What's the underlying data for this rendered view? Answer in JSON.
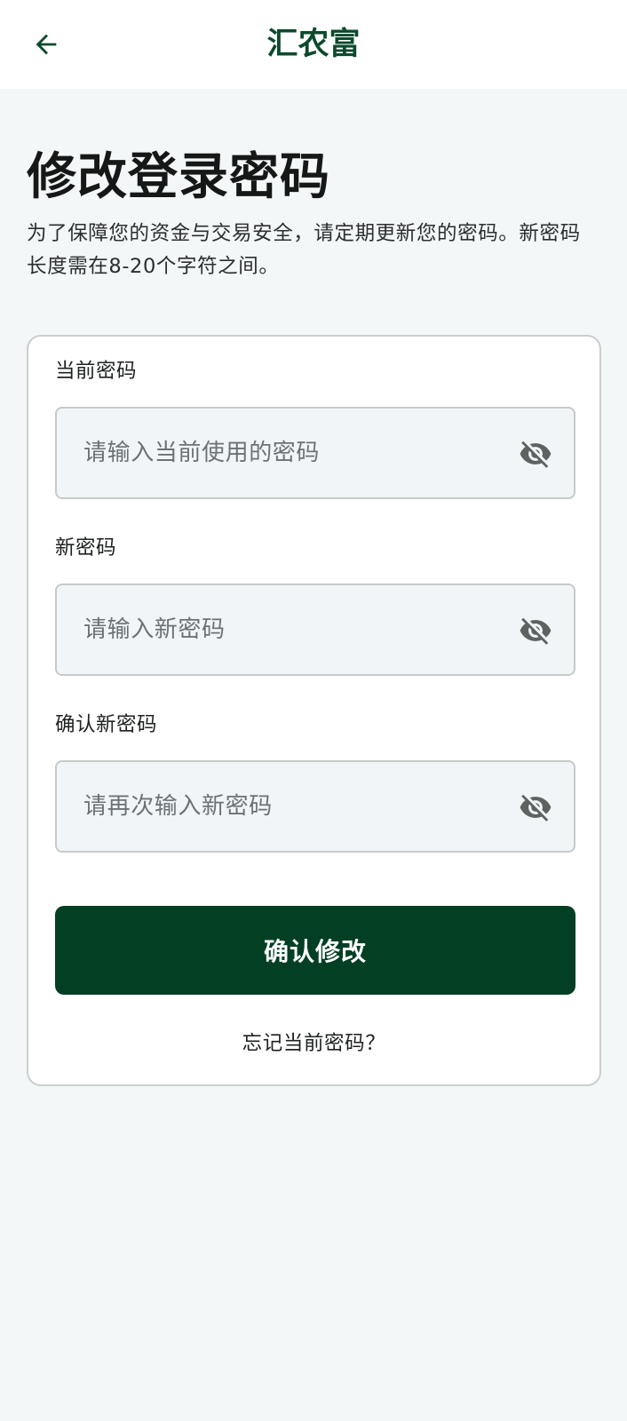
{
  "header": {
    "title": "汇农富",
    "back_icon": "arrow-left-icon"
  },
  "page": {
    "title": "修改登录密码",
    "description": "为了保障您的资金与交易安全，请定期更新您的密码。新密码长度需在8-20个字符之间。"
  },
  "form": {
    "current_password": {
      "label": "当前密码",
      "placeholder": "请输入当前使用的密码",
      "value": "",
      "toggle_icon": "eye-off-icon"
    },
    "new_password": {
      "label": "新密码",
      "placeholder": "请输入新密码",
      "value": "",
      "toggle_icon": "eye-off-icon"
    },
    "confirm_password": {
      "label": "确认新密码",
      "placeholder": "请再次输入新密码",
      "value": "",
      "toggle_icon": "eye-off-icon"
    },
    "submit_label": "确认修改",
    "forgot_link": "忘记当前密码？"
  },
  "colors": {
    "brand_green": "#0b4a2c",
    "button_green": "#023f23",
    "page_background": "#f4f7f8",
    "input_background": "#f1f5f7",
    "icon_gray": "#5d6361"
  }
}
